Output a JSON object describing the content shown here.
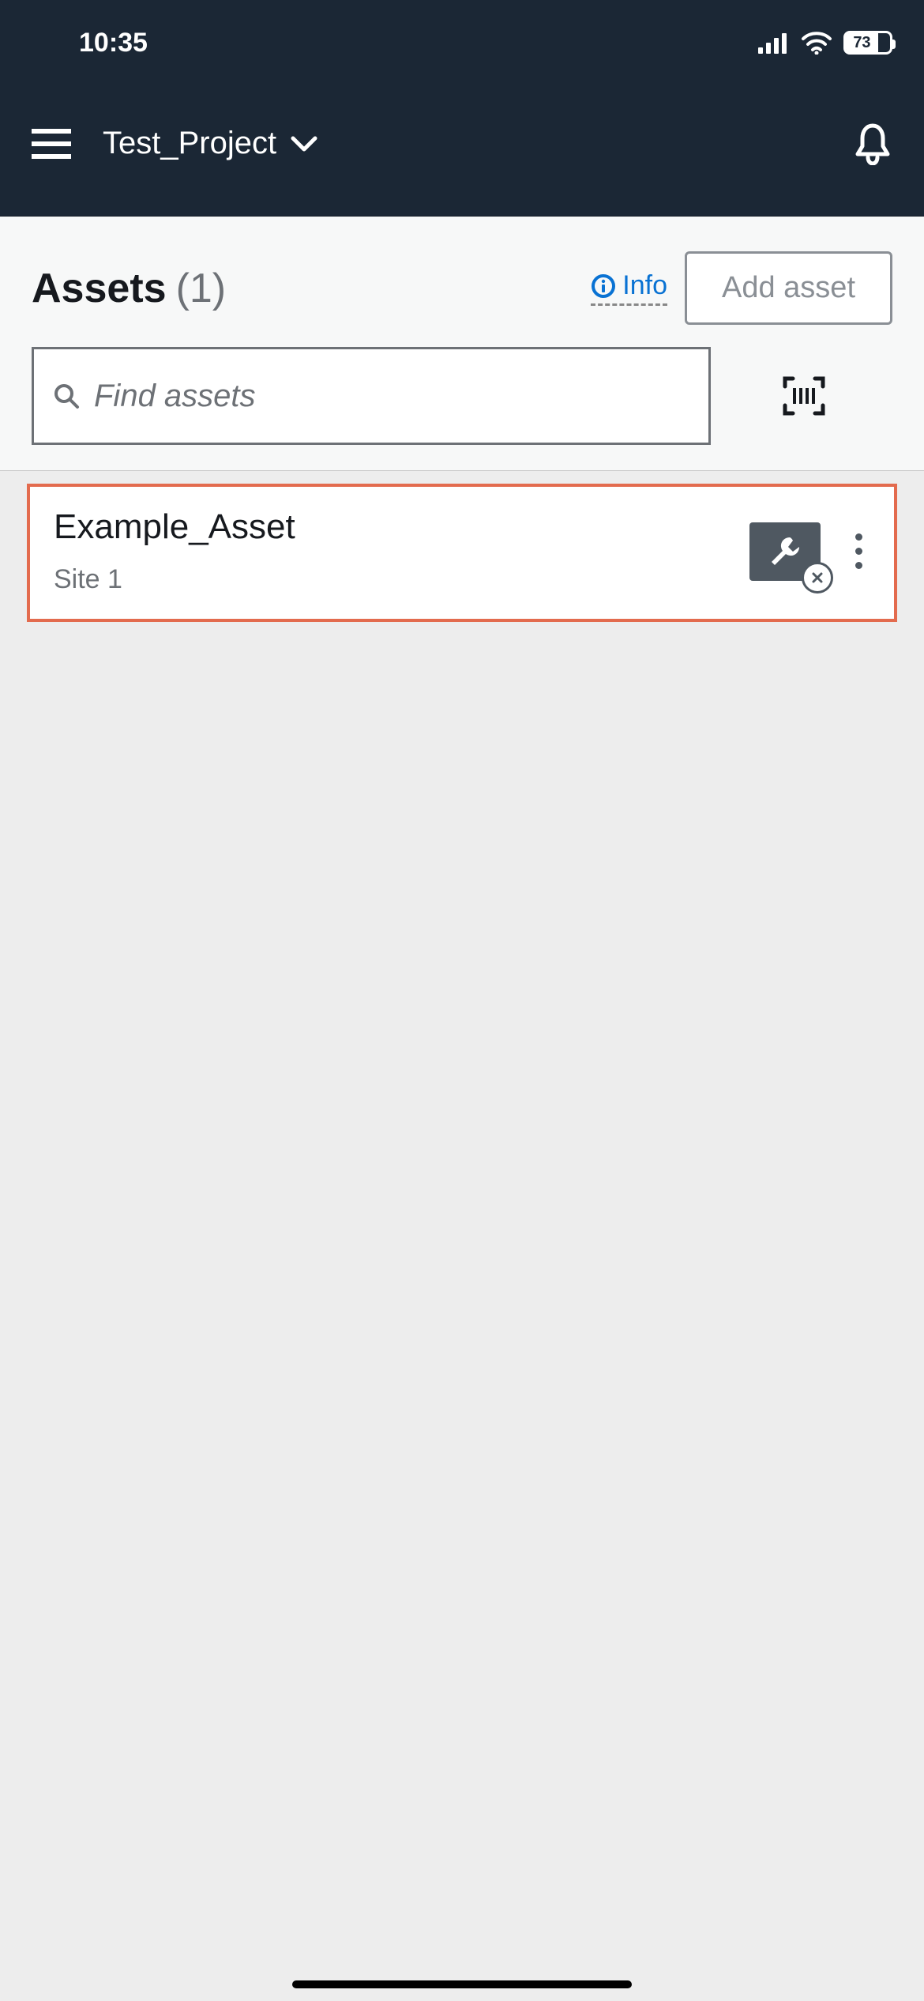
{
  "status": {
    "time": "10:35",
    "battery": "73"
  },
  "nav": {
    "project": "Test_Project"
  },
  "page": {
    "title": "Assets",
    "count": "(1)",
    "info_label": "Info",
    "add_asset_label": "Add asset",
    "search_placeholder": "Find assets"
  },
  "asset": {
    "name": "Example_Asset",
    "site": "Site 1"
  }
}
